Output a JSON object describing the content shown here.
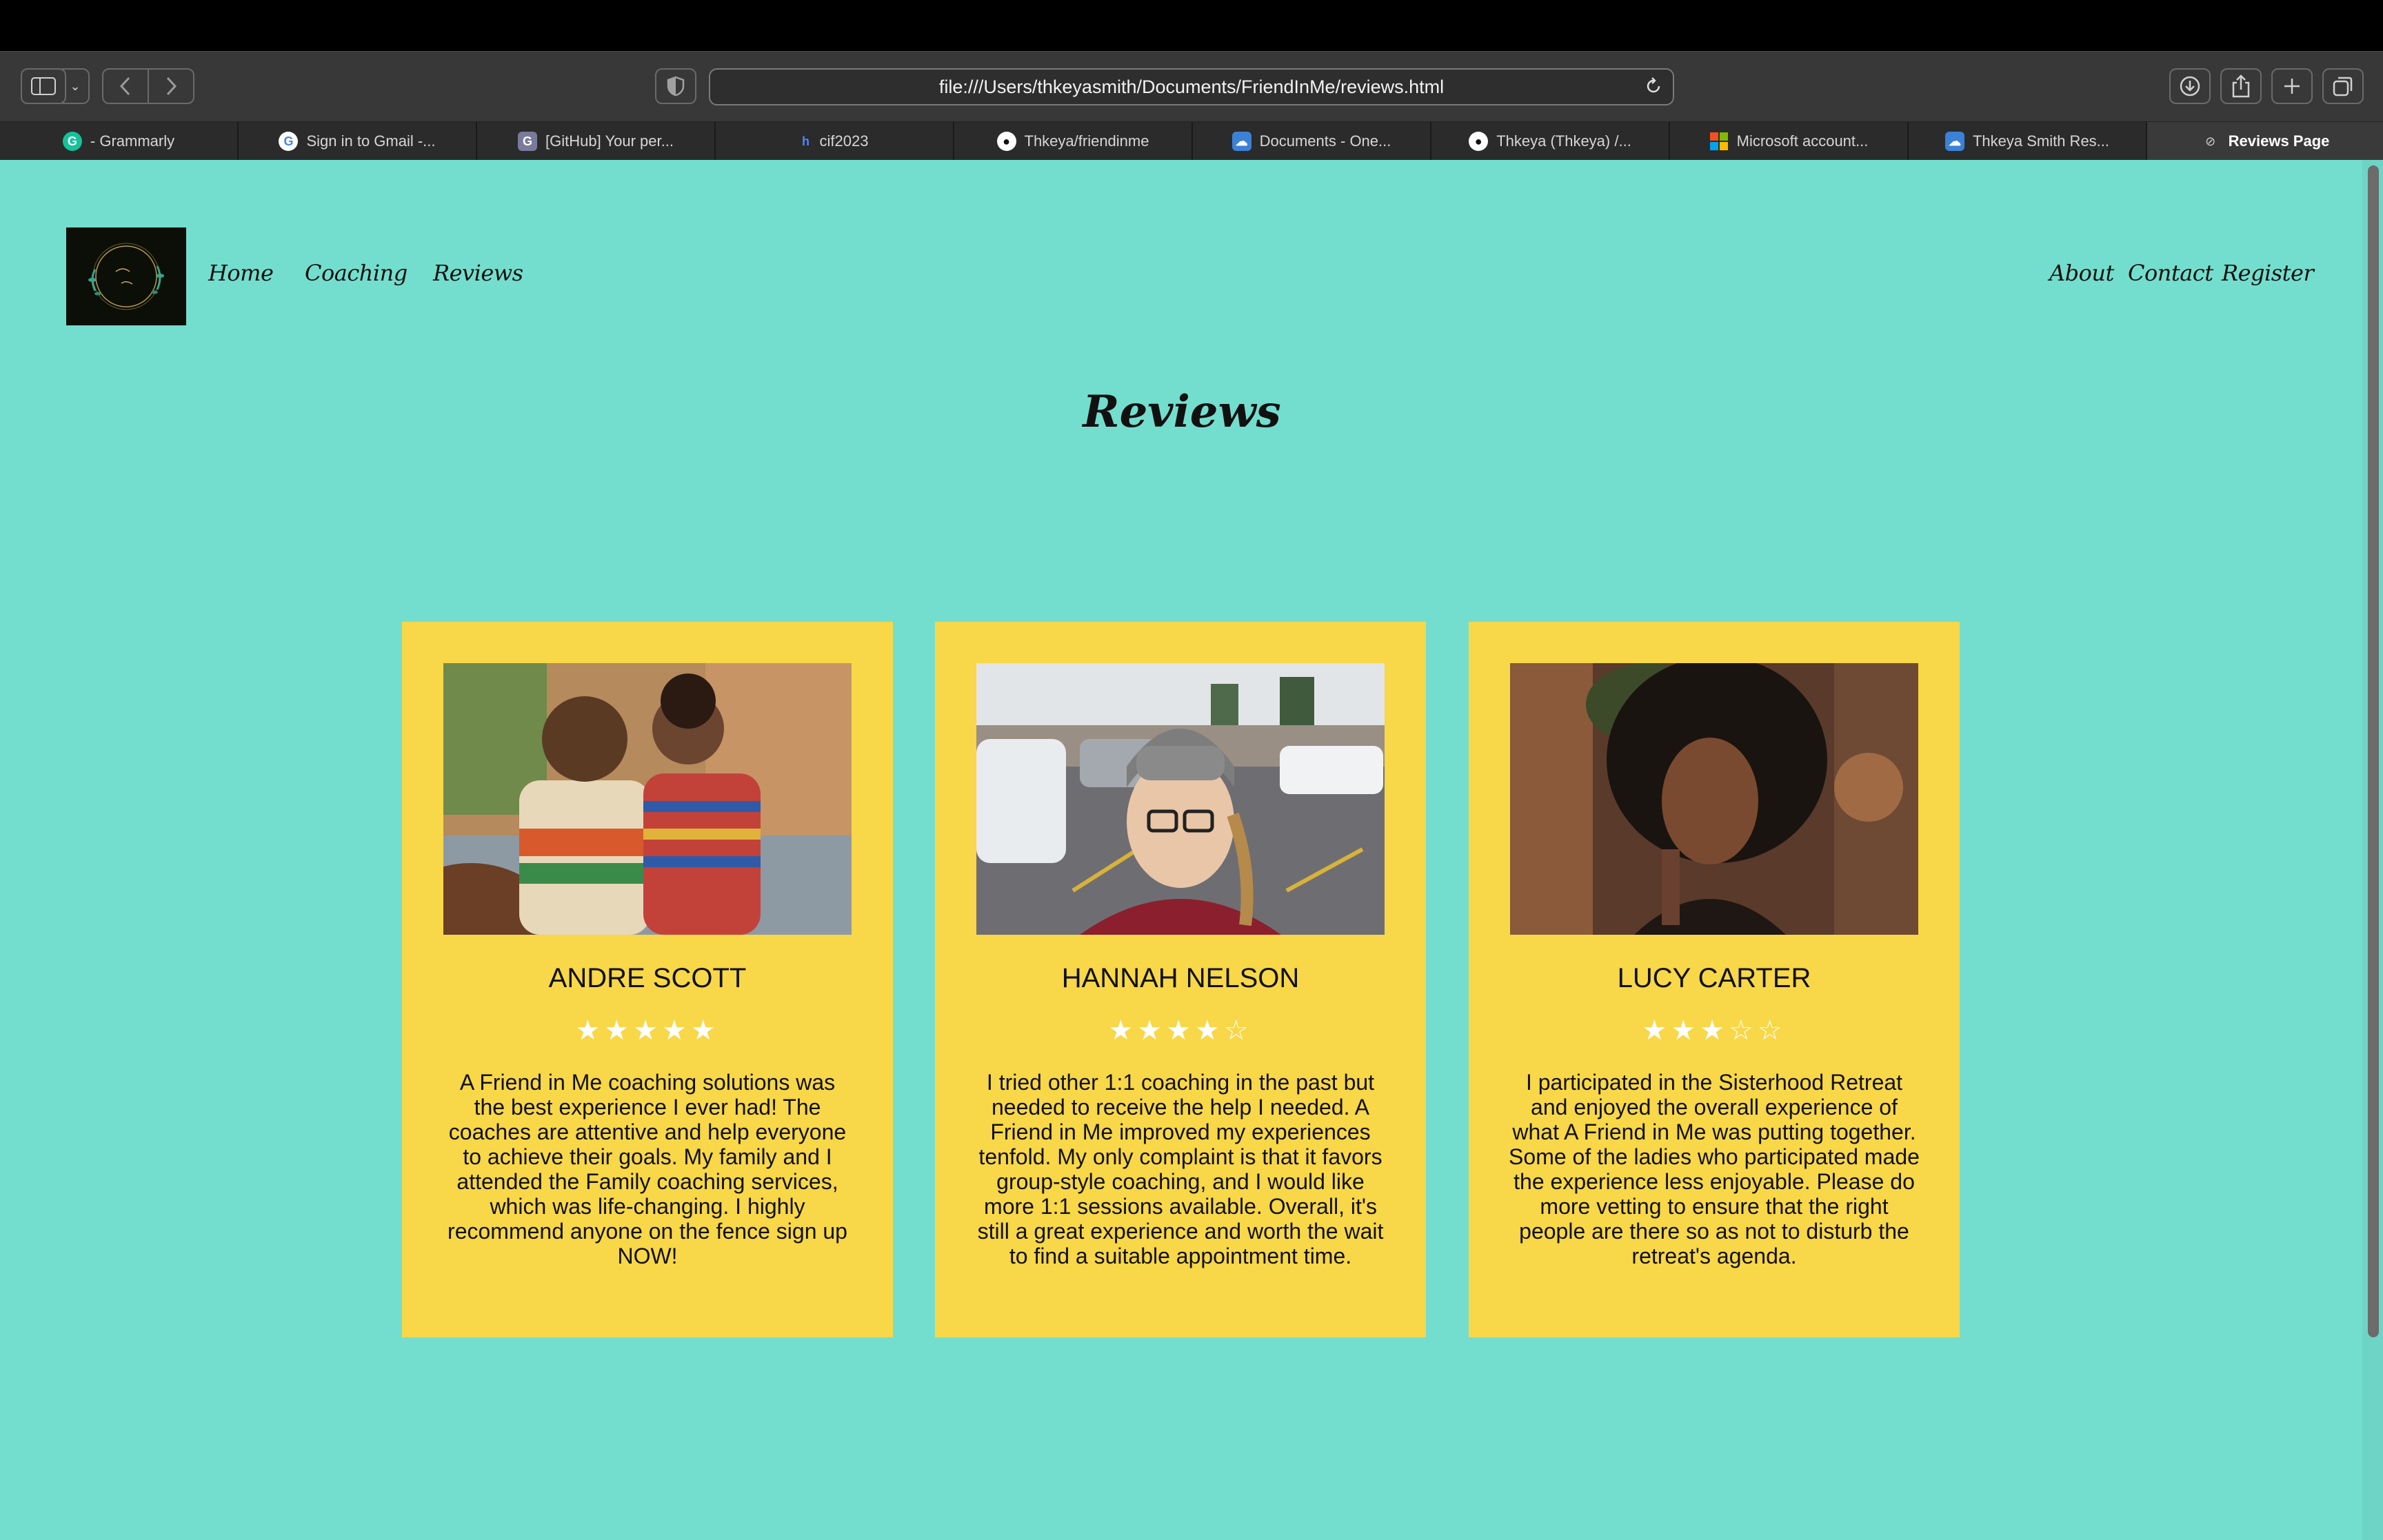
{
  "browser": {
    "url": "file:///Users/thkeyasmith/Documents/FriendInMe/reviews.html",
    "tabs": [
      {
        "label": "- Grammarly",
        "icon": "grammarly-icon",
        "fav": "G",
        "color": "#15c39a"
      },
      {
        "label": "Sign in to Gmail -...",
        "icon": "google-icon",
        "fav": "G",
        "color": "#ffffff"
      },
      {
        "label": "[GitHub] Your per...",
        "icon": "gmail-icon",
        "fav": "G",
        "color": "#7a7a9a"
      },
      {
        "label": "cif2023",
        "icon": "hackerrank-icon",
        "fav": "h",
        "color": "#2b2b2b"
      },
      {
        "label": "Thkeya/friendinme",
        "icon": "github-icon",
        "fav": "●",
        "color": "#ffffff"
      },
      {
        "label": "Documents - One...",
        "icon": "onedrive-icon",
        "fav": "☁",
        "color": "#3b82d6"
      },
      {
        "label": "Thkeya (Thkeya) /...",
        "icon": "github-icon",
        "fav": "●",
        "color": "#ffffff"
      },
      {
        "label": "Microsoft account...",
        "icon": "microsoft-icon",
        "fav": "▦",
        "color": "#f25022"
      },
      {
        "label": "Thkeya Smith Res...",
        "icon": "onedrive-icon",
        "fav": "☁",
        "color": "#3b82d6"
      },
      {
        "label": "Reviews Page",
        "icon": "compass-icon",
        "fav": "⊘",
        "color": "#3a3a3a"
      }
    ]
  },
  "nav": {
    "left": [
      "Home",
      "Coaching",
      "Reviews"
    ],
    "right": [
      "About",
      "Contact",
      "Register"
    ]
  },
  "page": {
    "title": "Reviews"
  },
  "reviews": [
    {
      "name": "ANDRE SCOTT",
      "rating": 5,
      "stars": "★★★★★",
      "text": "A Friend in Me coaching solutions was the best experience I ever had! The coaches are attentive and help everyone to achieve their goals. My family and I attended the Family coaching services, which was life-changing. I highly recommend anyone on the fence sign up NOW!"
    },
    {
      "name": "HANNAH NELSON",
      "rating": 4,
      "stars": "★★★★☆",
      "text": "I tried other 1:1 coaching in the past but needed to receive the help I needed. A Friend in Me improved my experiences tenfold. My only complaint is that it favors group-style coaching, and I would like more 1:1 sessions available. Overall, it's still a great experience and worth the wait to find a suitable appointment time."
    },
    {
      "name": "LUCY CARTER",
      "rating": 3,
      "stars": "★★★☆☆",
      "text": "I participated in the Sisterhood Retreat and enjoyed the overall experience of what A Friend in Me was putting together. Some of the ladies who participated made the experience less enjoyable. Please do more vetting to ensure that the right people are there so as not to disturb the retreat's agenda."
    }
  ],
  "colors": {
    "page_bg": "#74dece",
    "card_bg": "#f8d748",
    "star": "#ffffff"
  }
}
